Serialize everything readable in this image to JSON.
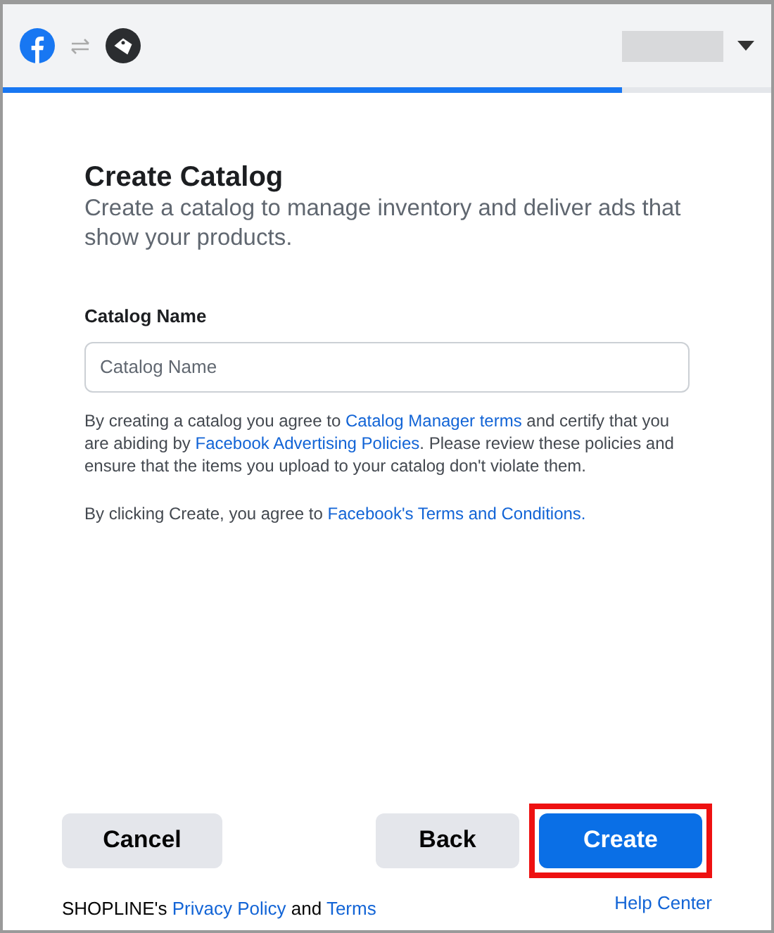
{
  "header": {
    "progress": {
      "level": 0.805
    }
  },
  "title": "Create Catalog",
  "subtitle": "Create a catalog to manage inventory and deliver ads that show your products.",
  "field": {
    "label": "Catalog Name",
    "placeholder": "Catalog Name"
  },
  "paragraphs": [
    [
      {
        "kind": "text",
        "text": "By creating a catalog you agree to "
      },
      {
        "kind": "link",
        "text": "Catalog Manager terms"
      },
      {
        "kind": "text",
        "text": " and certify that you are abiding by "
      },
      {
        "kind": "link",
        "text": "Facebook Advertising Policies"
      },
      {
        "kind": "text",
        "text": ". Please review these policies and ensure that the items you upload to your catalog don't violate them."
      }
    ],
    [
      {
        "kind": "text",
        "text": "By clicking Create, you agree to "
      },
      {
        "kind": "link",
        "text": "Facebook's Terms and Conditions."
      }
    ]
  ],
  "buttons": [
    {
      "label": "Cancel",
      "kind": "secondary",
      "highlighted": false
    },
    {
      "label": "Back",
      "kind": "secondary",
      "highlighted": false
    },
    {
      "label": "Create",
      "kind": "primary",
      "highlighted": true
    }
  ],
  "footer": [
    {
      "kind": "text",
      "text": "SHOPLINE's "
    },
    {
      "kind": "link",
      "text": "Privacy Policy"
    },
    {
      "kind": "text",
      "text": " and "
    },
    {
      "kind": "link",
      "text": "Terms"
    }
  ],
  "help_link": "Help Center"
}
